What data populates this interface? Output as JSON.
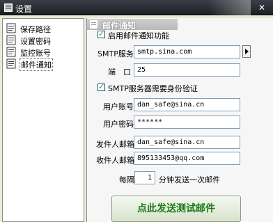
{
  "window": {
    "title": "设置",
    "close_symbol": "✕"
  },
  "sidebar": {
    "items": [
      {
        "label": "保存路径"
      },
      {
        "label": "设置密码"
      },
      {
        "label": "监控账号"
      },
      {
        "label": "邮件通知"
      }
    ],
    "selected": "邮件通知"
  },
  "section": {
    "title": "邮件通知"
  },
  "form": {
    "enable_notify": {
      "label": "启用邮件通知功能",
      "checked": true
    },
    "smtp_server": {
      "label": "SMTP服务器",
      "value": "smtp.sina.com"
    },
    "port": {
      "label": "端　口",
      "value": "25"
    },
    "smtp_auth": {
      "label": "SMTP服务器需要身份验证",
      "checked": true
    },
    "user_account": {
      "label": "用户账号",
      "value": "dan_safe@sina.cn"
    },
    "user_password": {
      "label": "用户密码",
      "value": "******"
    },
    "sender_email": {
      "label": "发件人邮箱",
      "value": "dan_safe@sina.cn"
    },
    "receiver_email": {
      "label": "收件人邮箱",
      "value": "895133453@qq.com"
    },
    "interval": {
      "prefix": "每隔",
      "value": "1",
      "suffix": "分钟发送一次邮件"
    }
  },
  "test_button": {
    "label": "点此发送测试邮件"
  },
  "colors": {
    "title_bar": "#25292e",
    "button_text": "#1d7a1d",
    "check_mark": "#21a121"
  }
}
